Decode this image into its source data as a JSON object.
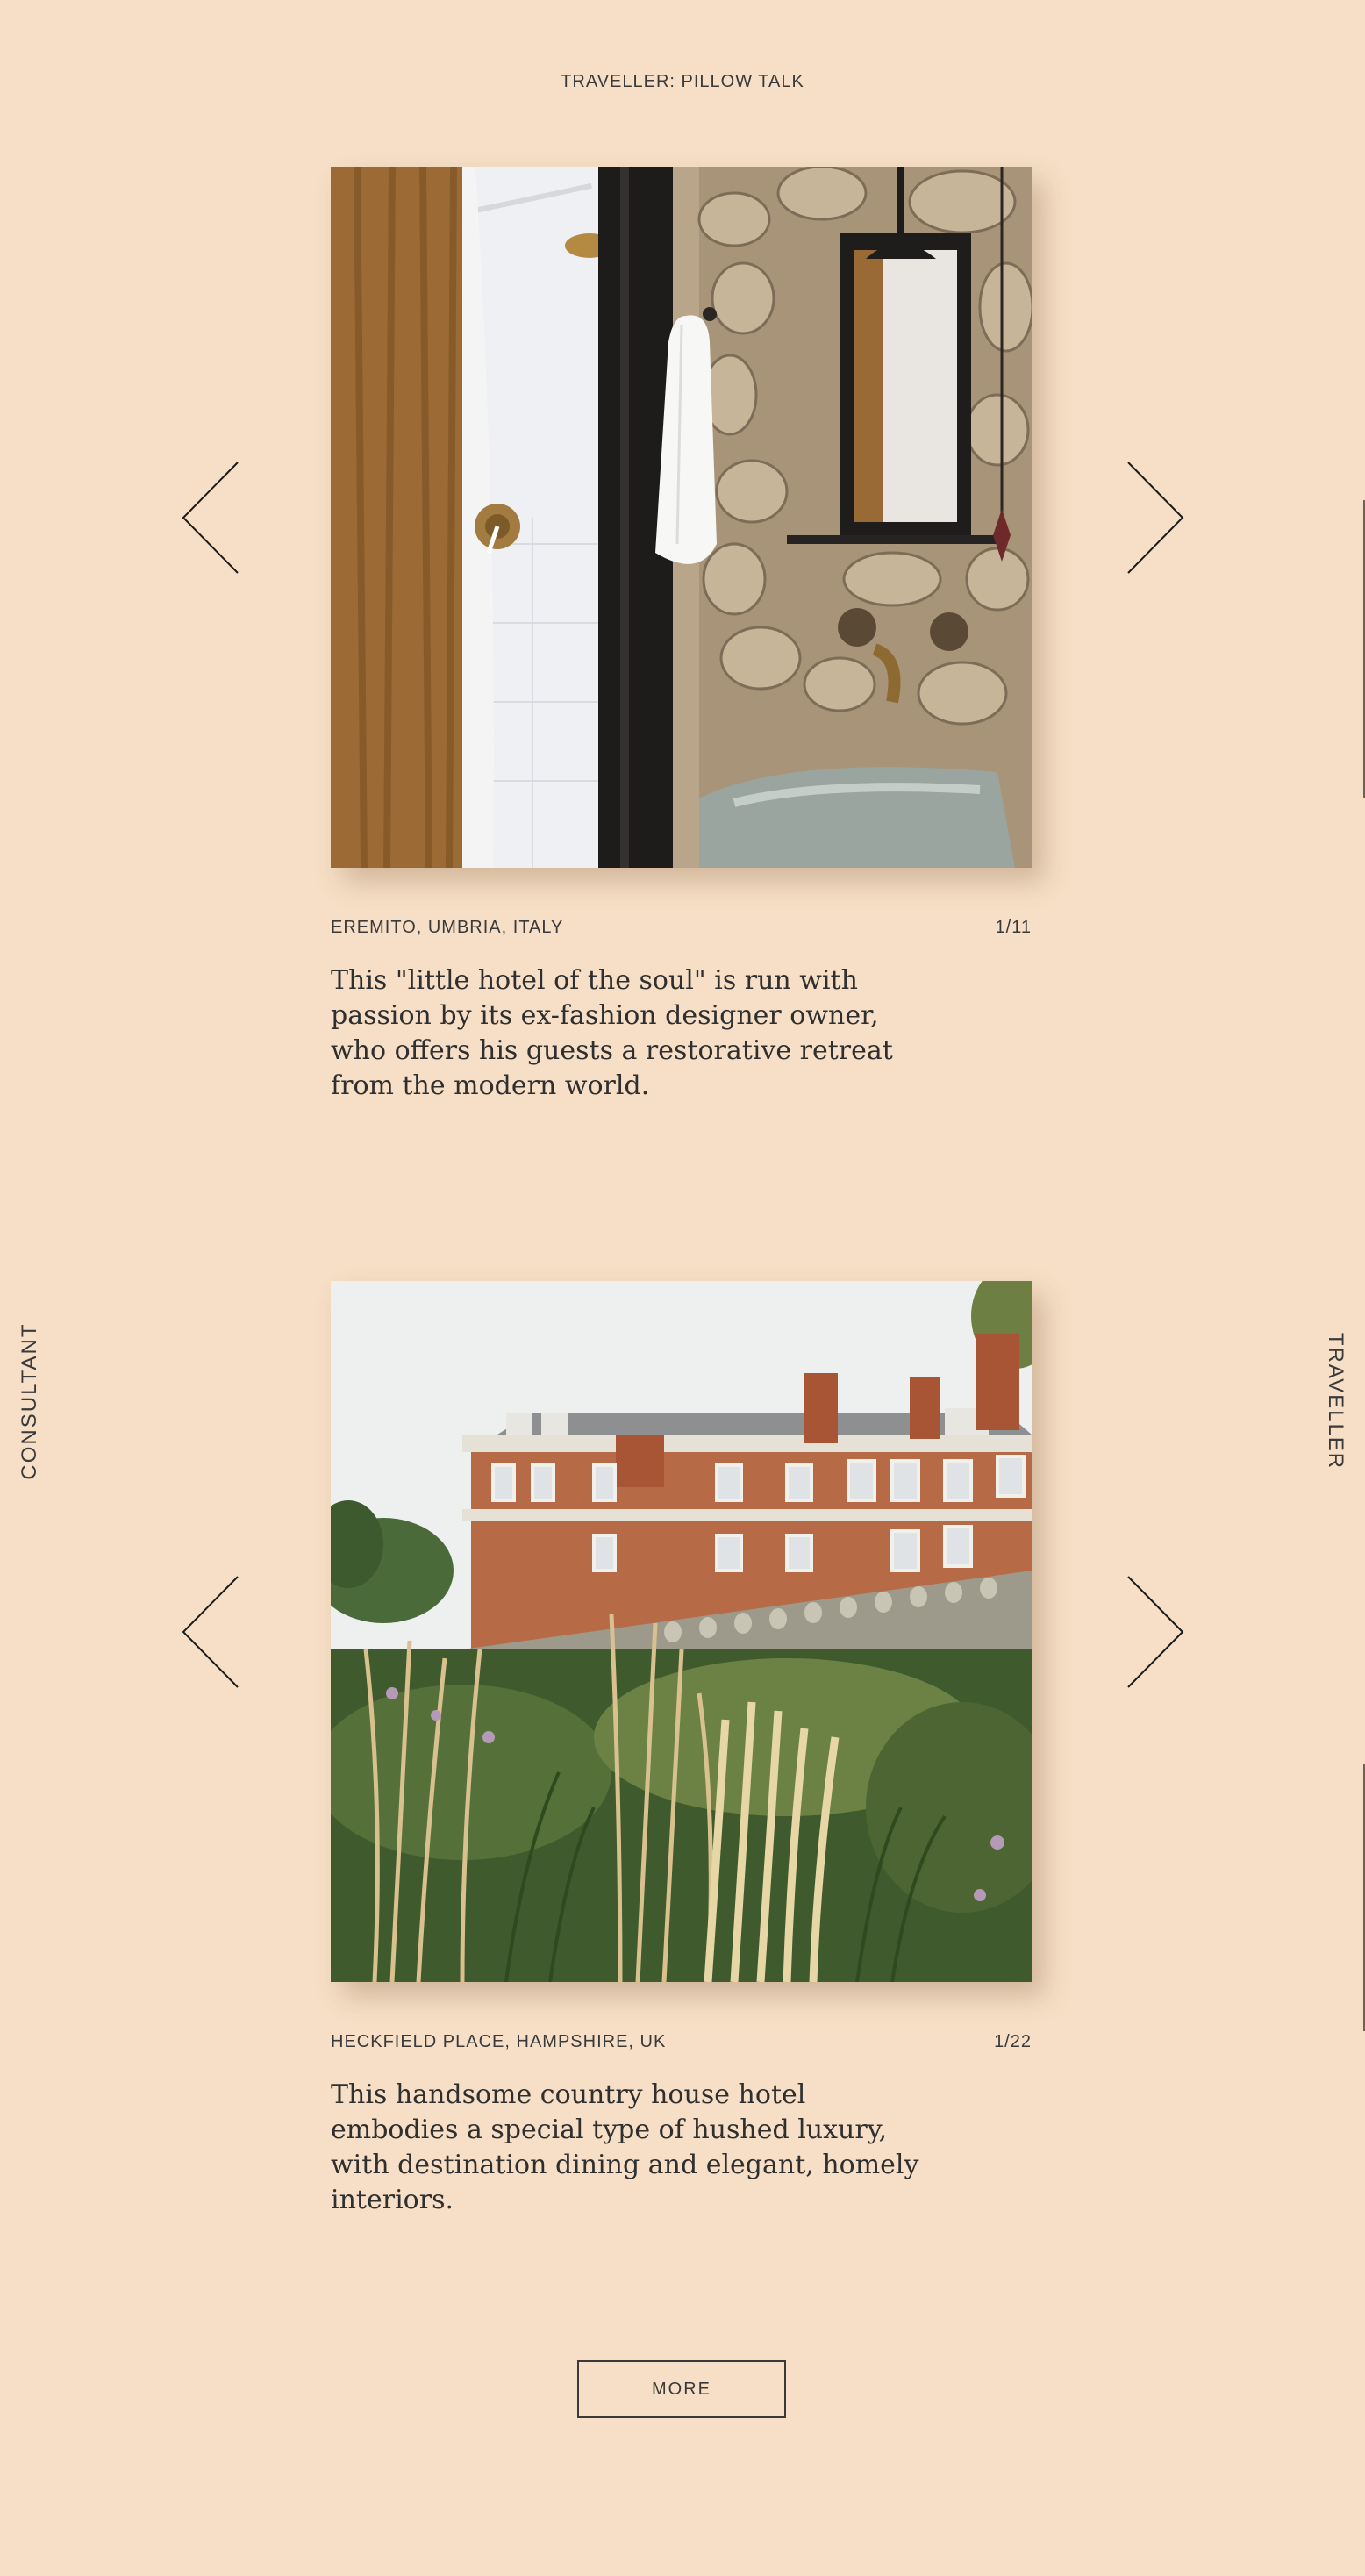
{
  "header": {
    "title": "TRAVELLER: PILLOW TALK"
  },
  "side_labels": {
    "left": "CONSULTANT",
    "right": "TRAVELLER"
  },
  "slides": [
    {
      "location": "EREMITO, UMBRIA, ITALY",
      "counter": "1/11",
      "description": "This \"little hotel of the soul\" is run with passion by its ex-fashion designer owner, who offers his guests a restorative retreat from the modern world.",
      "photo_subject": "rustic stone bathroom with shower curtain, towel, mirror and stone sink"
    },
    {
      "location": "HECKFIELD PLACE, HAMPSHIRE, UK",
      "counter": "1/22",
      "description": "This handsome country house hotel embodies a special type of hushed luxury, with destination dining and elegant, homely interiors.",
      "photo_subject": "brick country house behind tall ornamental grasses"
    }
  ],
  "more_button": {
    "label": "MORE"
  },
  "icons": {
    "prev": "chevron-left-icon",
    "next": "chevron-right-icon"
  },
  "colors": {
    "background": "#f6dfc6",
    "text": "#2b2b2b"
  }
}
